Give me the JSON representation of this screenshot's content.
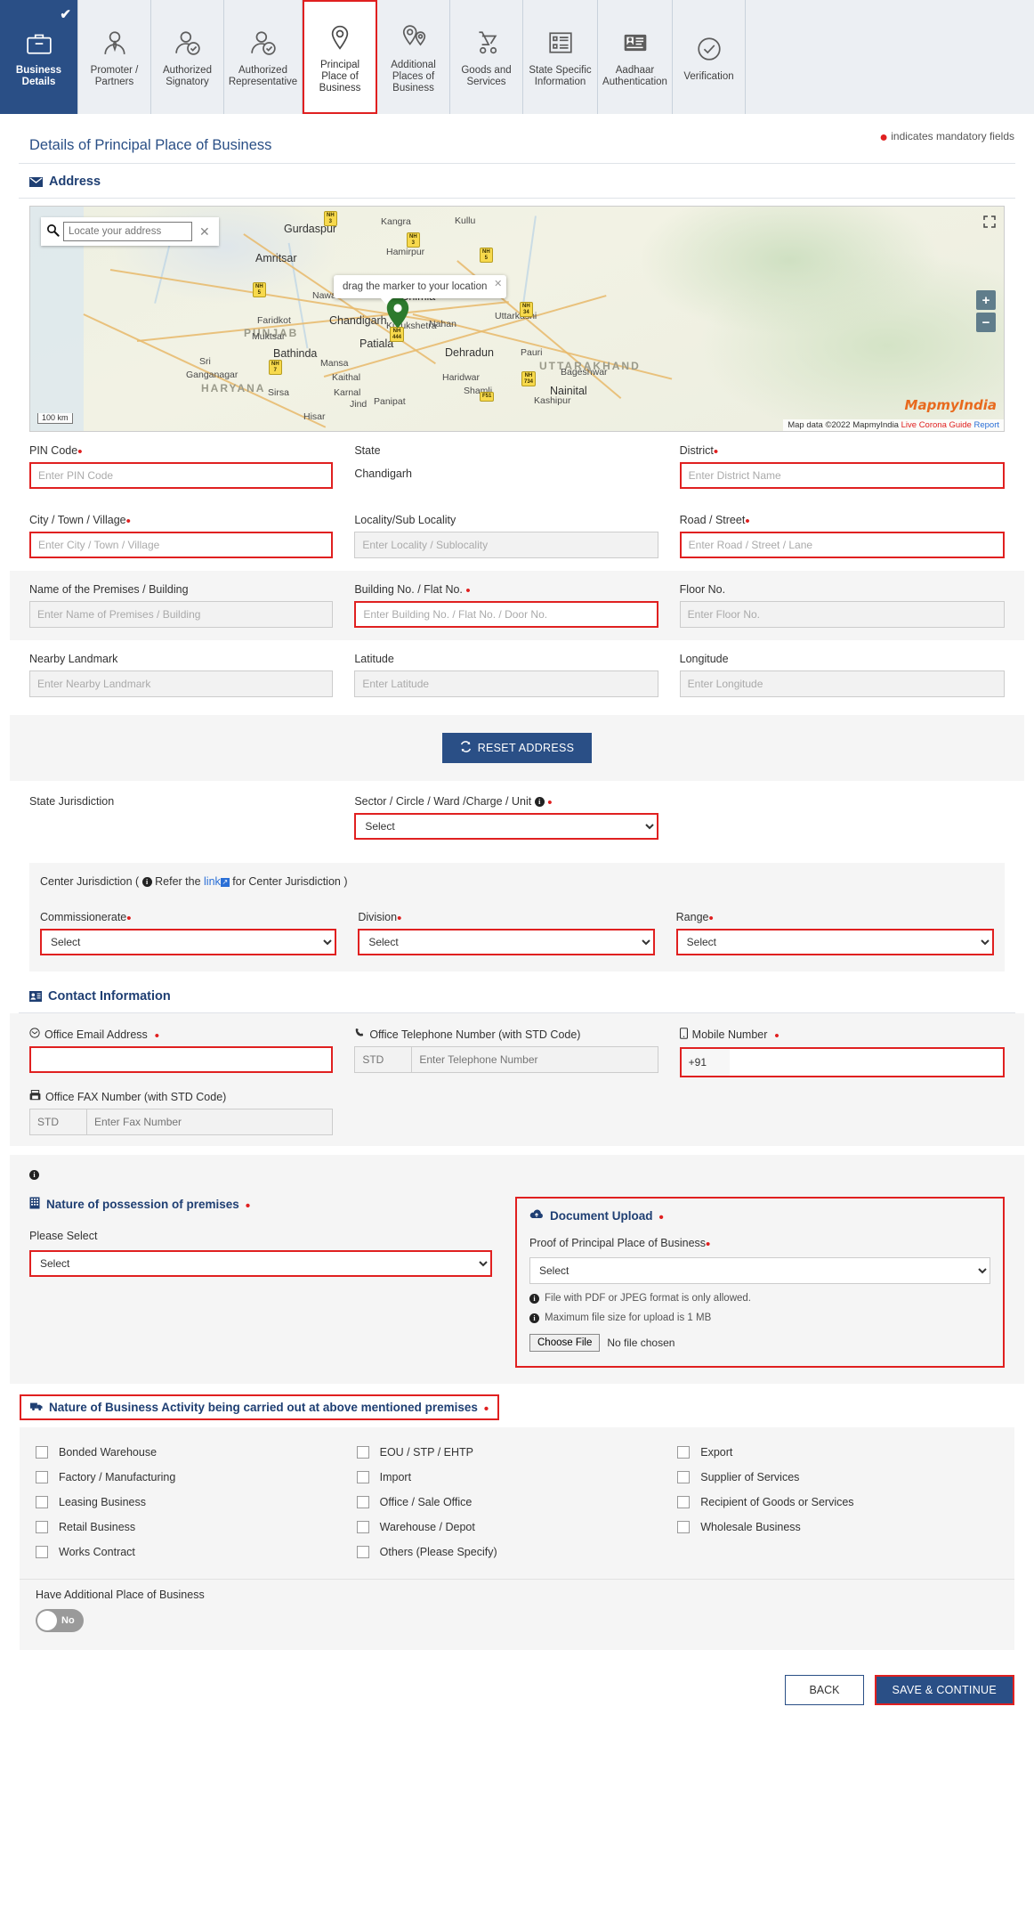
{
  "tabs": [
    {
      "label": "Business Details",
      "icon": "briefcase-icon",
      "state": "active",
      "completed": true
    },
    {
      "label": "Promoter / Partners",
      "icon": "person-tie-icon",
      "state": "normal",
      "completed": false
    },
    {
      "label": "Authorized Signatory",
      "icon": "person-check-icon",
      "state": "normal",
      "completed": false
    },
    {
      "label": "Authorized Representative",
      "icon": "person-check-icon",
      "state": "normal",
      "completed": false
    },
    {
      "label": "Principal Place of Business",
      "icon": "map-pin-icon",
      "state": "current",
      "completed": false
    },
    {
      "label": "Additional Places of Business",
      "icon": "map-pins-icon",
      "state": "normal",
      "completed": false
    },
    {
      "label": "Goods and Services",
      "icon": "trolley-icon",
      "state": "normal",
      "completed": false
    },
    {
      "label": "State Specific Information",
      "icon": "form-list-icon",
      "state": "normal",
      "completed": false
    },
    {
      "label": "Aadhaar Authentication",
      "icon": "id-card-icon",
      "state": "normal",
      "completed": false
    },
    {
      "label": "Verification",
      "icon": "check-circle-icon",
      "state": "normal",
      "completed": false
    }
  ],
  "mandatory_note": "indicates mandatory fields",
  "page_title": "Details of Principal Place of Business",
  "address_section": {
    "heading": "Address",
    "icon": "envelope-icon"
  },
  "map": {
    "search_placeholder": "Locate your address",
    "search_value": "",
    "tooltip": "drag the marker to your location",
    "zoom_in": "+",
    "zoom_out": "−",
    "scale_label": "100 km",
    "brand": "MapmyIndia",
    "attribution": "Map data ©2022 MapmyIndia",
    "attribution_links": [
      "Live Corona Guide",
      "Report"
    ],
    "states": [
      "PUNJAB",
      "HARYANA",
      "UTTARAKHAND"
    ],
    "cities": [
      "Gurdaspur",
      "Kangra",
      "Kullu",
      "Amritsar",
      "Hamirpur",
      "Nawanshahr",
      "Shimla",
      "Faridkot",
      "Chandigarh",
      "Nahan",
      "Uttarkashi",
      "Muktsar",
      "Patiala",
      "Dehradun",
      "Bathinda",
      "Mansa",
      "Pauri",
      "Bageshwar",
      "Sri Ganganagar",
      "Kaithal",
      "Haridwar",
      "Karnal",
      "Nainital",
      "Sirsa",
      "Jind",
      "Panipat",
      "Shamli",
      "Kashipur",
      "Hisar",
      "Kurukshetra"
    ]
  },
  "fields": {
    "pin_code": {
      "label": "PIN Code",
      "placeholder": "Enter PIN Code",
      "value": "",
      "required": true
    },
    "state": {
      "label": "State",
      "value": "Chandigarh",
      "required": false
    },
    "district": {
      "label": "District",
      "placeholder": "Enter District Name",
      "value": "",
      "required": true
    },
    "city": {
      "label": "City / Town / Village",
      "placeholder": "Enter City / Town / Village",
      "value": "",
      "required": true
    },
    "locality": {
      "label": "Locality/Sub Locality",
      "placeholder": "Enter Locality / Sublocality",
      "value": "",
      "required": false
    },
    "road": {
      "label": "Road / Street",
      "placeholder": "Enter Road / Street / Lane",
      "value": "",
      "required": true
    },
    "premises": {
      "label": "Name of the Premises / Building",
      "placeholder": "Enter Name of Premises / Building",
      "value": "",
      "required": false
    },
    "building_no": {
      "label": "Building No. / Flat No.",
      "placeholder": "Enter Building No. / Flat No. / Door No.",
      "value": "",
      "required": true
    },
    "floor_no": {
      "label": "Floor No.",
      "placeholder": "Enter Floor No.",
      "value": "",
      "required": false
    },
    "landmark": {
      "label": "Nearby Landmark",
      "placeholder": "Enter Nearby Landmark",
      "value": "",
      "required": false
    },
    "latitude": {
      "label": "Latitude",
      "placeholder": "Enter Latitude",
      "value": "",
      "required": false
    },
    "longitude": {
      "label": "Longitude",
      "placeholder": "Enter Longitude",
      "value": "",
      "required": false
    }
  },
  "reset_button": "RESET ADDRESS",
  "jurisdiction": {
    "state_label": "State Jurisdiction",
    "sector_label": "Sector / Circle / Ward /Charge / Unit",
    "sector_value": "Select",
    "center_heading_pre": "Center Jurisdiction (",
    "center_heading_refer": "Refer the",
    "center_link": "link",
    "center_heading_post": "for Center Jurisdiction )",
    "commissionerate_label": "Commissionerate",
    "commissionerate_value": "Select",
    "division_label": "Division",
    "division_value": "Select",
    "range_label": "Range",
    "range_value": "Select",
    "select_option": "Select"
  },
  "contact": {
    "heading": "Contact Information",
    "email_label": "Office Email Address",
    "email_value": "",
    "telephone_label": "Office Telephone Number (with STD Code)",
    "telephone_std_placeholder": "STD",
    "telephone_placeholder": "Enter Telephone Number",
    "mobile_label": "Mobile Number",
    "mobile_prefix": "+91",
    "mobile_value": "",
    "fax_label": "Office FAX Number (with STD Code)",
    "fax_std_placeholder": "STD",
    "fax_placeholder": "Enter Fax Number"
  },
  "possession": {
    "heading": "Nature of possession of premises",
    "sub_label": "Please Select",
    "value": "Select"
  },
  "upload": {
    "heading": "Document Upload",
    "proof_label": "Proof of Principal Place of Business",
    "proof_value": "Select",
    "note_format": "File with PDF or JPEG format is only allowed.",
    "note_size": "Maximum file size for upload is 1 MB",
    "choose_file_button": "Choose File",
    "file_status": "No file chosen"
  },
  "activity": {
    "heading": "Nature of Business Activity being carried out at above mentioned premises",
    "options": [
      "Bonded Warehouse",
      "EOU / STP / EHTP",
      "Export",
      "Factory / Manufacturing",
      "Import",
      "Supplier of Services",
      "Leasing Business",
      "Office / Sale Office",
      "Recipient of Goods or Services",
      "Retail Business",
      "Warehouse / Depot",
      "Wholesale Business",
      "Works Contract",
      "Others (Please Specify)"
    ]
  },
  "additional_place": {
    "label": "Have Additional Place of Business",
    "toggle_value": "No"
  },
  "footer": {
    "back": "BACK",
    "save_continue": "SAVE & CONTINUE"
  },
  "colors": {
    "brand_blue": "#2a4f86",
    "required_red": "#e02020",
    "heading_navy": "#1f3f73",
    "link_blue": "#2a6fd6"
  }
}
